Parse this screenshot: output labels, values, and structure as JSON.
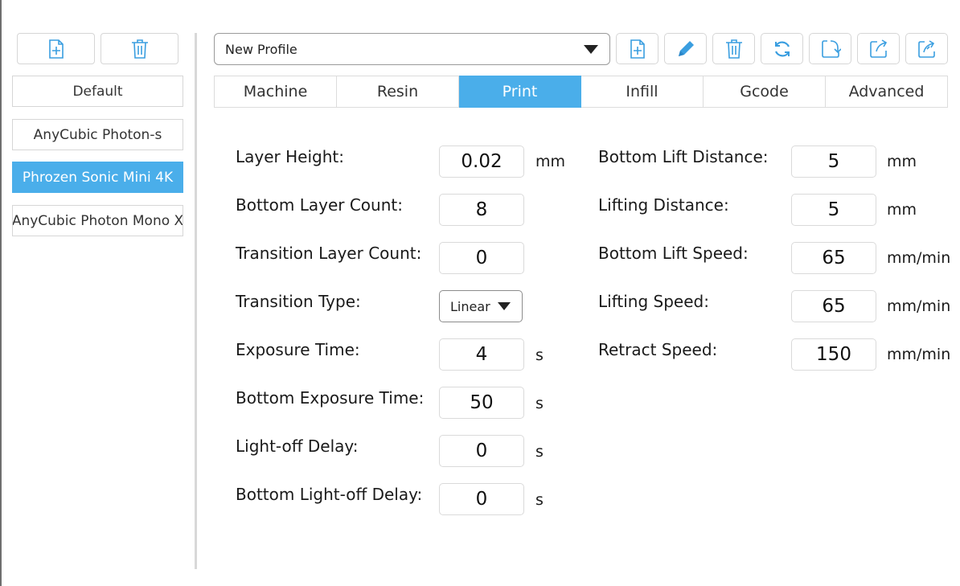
{
  "sidebar": {
    "profiles": [
      {
        "label": "Default"
      },
      {
        "label": "AnyCubic Photon-s"
      },
      {
        "label": "Phrozen Sonic Mini 4K"
      },
      {
        "label": "AnyCubic Photon Mono X"
      }
    ],
    "active_profile": "Phrozen Sonic Mini 4K"
  },
  "toolbar": {
    "profile_select_value": "New Profile"
  },
  "tabs": [
    {
      "label": "Machine"
    },
    {
      "label": "Resin"
    },
    {
      "label": "Print"
    },
    {
      "label": "Infill"
    },
    {
      "label": "Gcode"
    },
    {
      "label": "Advanced"
    }
  ],
  "active_tab": "Print",
  "left_fields": [
    {
      "label": "Layer Height:",
      "value": "0.02",
      "unit": "mm"
    },
    {
      "label": "Bottom Layer Count:",
      "value": "8",
      "unit": ""
    },
    {
      "label": "Transition Layer Count:",
      "value": "0",
      "unit": ""
    },
    {
      "label": "Transition Type:",
      "value": "Linear",
      "unit": ""
    },
    {
      "label": "Exposure Time:",
      "value": "4",
      "unit": "s"
    },
    {
      "label": "Bottom Exposure Time:",
      "value": "50",
      "unit": "s"
    },
    {
      "label": "Light-off Delay:",
      "value": "0",
      "unit": "s"
    },
    {
      "label": "Bottom Light-off Delay:",
      "value": "0",
      "unit": "s"
    }
  ],
  "right_fields": [
    {
      "label": "Bottom Lift Distance:",
      "value": "5",
      "unit": "mm"
    },
    {
      "label": "Lifting Distance:",
      "value": "5",
      "unit": "mm"
    },
    {
      "label": "Bottom Lift Speed:",
      "value": "65",
      "unit": "mm/min"
    },
    {
      "label": "Lifting Speed:",
      "value": "65",
      "unit": "mm/min"
    },
    {
      "label": "Retract Speed:",
      "value": "150",
      "unit": "mm/min"
    }
  ],
  "colors": {
    "accent": "#4aaeea",
    "border": "#d6d6d6"
  },
  "icons": {
    "sidebar_add": "file-plus-icon",
    "sidebar_delete": "trash-icon",
    "tool_new": "file-plus-icon",
    "tool_edit": "pencil-icon",
    "tool_delete": "trash-icon",
    "tool_reset": "refresh-icon",
    "tool_import": "import-icon",
    "tool_export": "export-icon",
    "tool_export_all": "export-all-icon"
  }
}
